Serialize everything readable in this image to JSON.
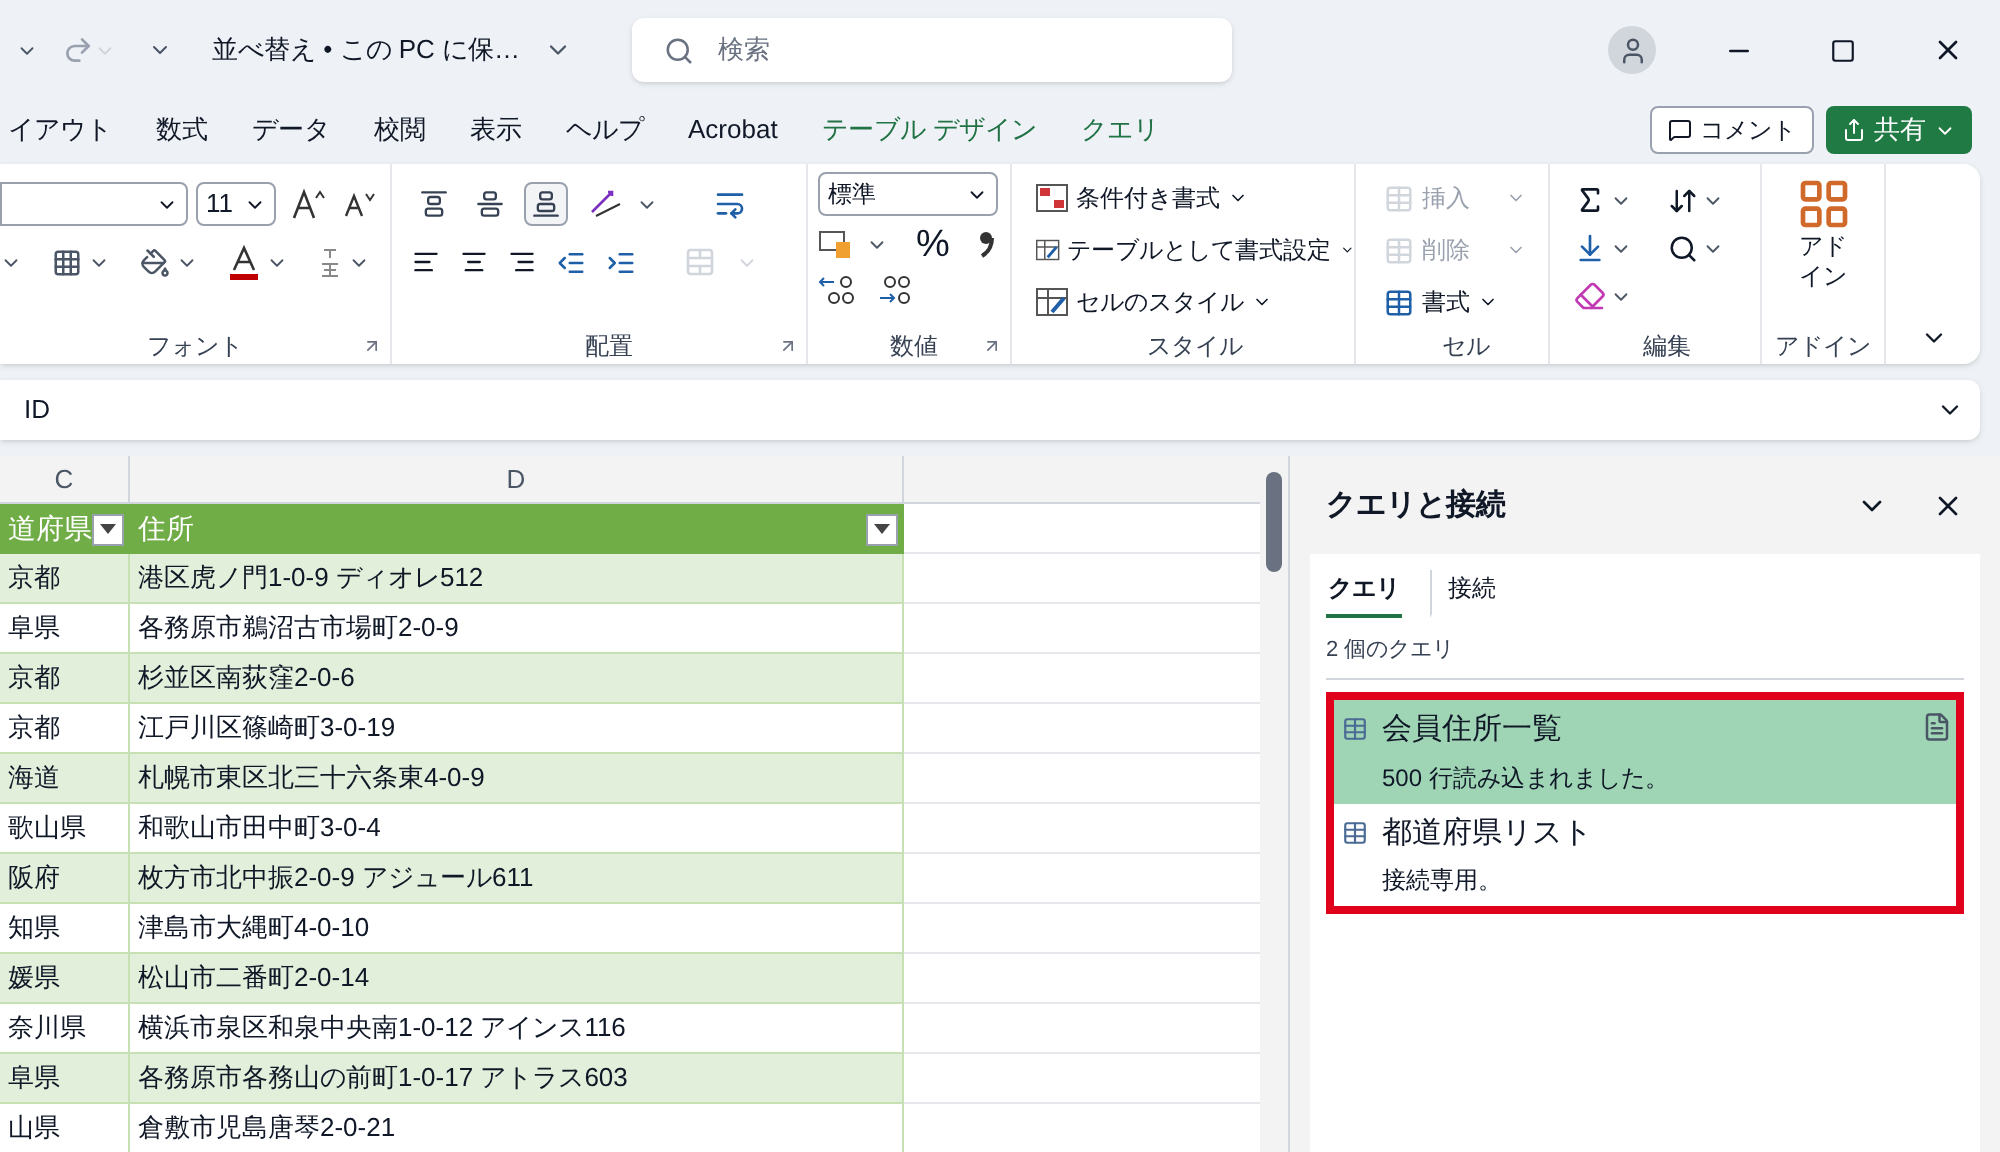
{
  "title_bar": {
    "file_name": "並べ替え • この PC に保…",
    "search_placeholder": "検索"
  },
  "ribbon_tabs": [
    {
      "label": "イアウト",
      "contextual": false
    },
    {
      "label": "数式",
      "contextual": false
    },
    {
      "label": "データ",
      "contextual": false
    },
    {
      "label": "校閲",
      "contextual": false
    },
    {
      "label": "表示",
      "contextual": false
    },
    {
      "label": "ヘルプ",
      "contextual": false
    },
    {
      "label": "Acrobat",
      "contextual": false
    },
    {
      "label": "テーブル デザイン",
      "contextual": true
    },
    {
      "label": "クエリ",
      "contextual": true
    }
  ],
  "comment_button": "コメント",
  "share_button": "共有",
  "font_group": {
    "label": "フォント",
    "size": "11"
  },
  "alignment_group": {
    "label": "配置",
    "vertical": [
      {
        "selected": false
      },
      {
        "selected": false
      },
      {
        "selected": true
      }
    ],
    "merge_disabled": true
  },
  "number_group": {
    "label": "数値",
    "format": "標準",
    "percent": "%"
  },
  "style_group": {
    "label": "スタイル",
    "buttons": [
      "条件付き書式",
      "テーブルとして書式設定",
      "セルのスタイル"
    ]
  },
  "cells_group": {
    "label": "セル",
    "buttons": [
      {
        "label": "挿入",
        "disabled": true
      },
      {
        "label": "削除",
        "disabled": true
      },
      {
        "label": "書式",
        "disabled": false
      }
    ]
  },
  "editing_group": {
    "label": "編集"
  },
  "addin_group": {
    "label": "アドイン",
    "button": "アドイン"
  },
  "formula_bar": {
    "name_box": "ID"
  },
  "sheet": {
    "columns": [
      "C",
      "D"
    ],
    "header": [
      "道府県",
      "住所"
    ],
    "rows": [
      [
        "京都",
        "港区虎ノ門1-0-9 ディオレ512"
      ],
      [
        "阜県",
        "各務原市鵜沼古市場町2-0-9"
      ],
      [
        "京都",
        "杉並区南荻窪2-0-6"
      ],
      [
        "京都",
        "江戸川区篠崎町3-0-19"
      ],
      [
        "海道",
        "札幌市東区北三十六条東4-0-9"
      ],
      [
        "歌山県",
        "和歌山市田中町3-0-4"
      ],
      [
        "阪府",
        "枚方市北中振2-0-9 アジュール611"
      ],
      [
        "知県",
        "津島市大縄町4-0-10"
      ],
      [
        "媛県",
        "松山市二番町2-0-14"
      ],
      [
        "奈川県",
        "横浜市泉区和泉中央南1-0-12 アインス116"
      ],
      [
        "阜県",
        "各務原市各務山の前町1-0-17 アトラス603"
      ],
      [
        "山県",
        "倉敷市児島唐琴2-0-21"
      ]
    ]
  },
  "queries_pane": {
    "title": "クエリと接続",
    "tabs": [
      {
        "label": "クエリ",
        "selected": true
      },
      {
        "label": "接続",
        "selected": false
      }
    ],
    "count": "2 個のクエリ",
    "queries": [
      {
        "name": "会員住所一覧",
        "status": "500 行読み込まれました。",
        "selected": true
      },
      {
        "name": "都道府県リスト",
        "status": "接続専用。",
        "selected": false
      }
    ]
  }
}
